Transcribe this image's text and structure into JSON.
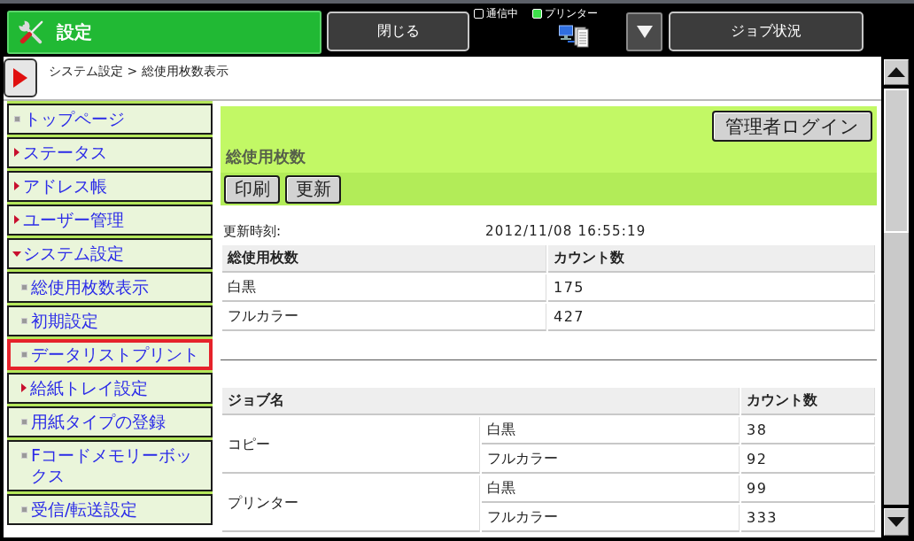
{
  "header": {
    "title": "設定",
    "close_button": "閉じる",
    "indicators": [
      {
        "label": "通信中",
        "on": false
      },
      {
        "label": "プリンター",
        "on": true
      }
    ],
    "job_status_button": "ジョブ状況"
  },
  "breadcrumb": "システム設定 > 総使用枚数表示",
  "sidebar": {
    "items": [
      {
        "label": "トップページ",
        "kind": "page",
        "selected": false
      },
      {
        "label": "ステータス",
        "kind": "folder",
        "expanded": false,
        "selected": false
      },
      {
        "label": "アドレス帳",
        "kind": "folder",
        "expanded": false,
        "selected": false
      },
      {
        "label": "ユーザー管理",
        "kind": "folder",
        "expanded": false,
        "selected": false
      },
      {
        "label": "システム設定",
        "kind": "folder",
        "expanded": true,
        "selected": false,
        "children": [
          {
            "label": "総使用枚数表示",
            "kind": "page",
            "selected": false
          },
          {
            "label": "初期設定",
            "kind": "page",
            "selected": false
          },
          {
            "label": "データリストプリント",
            "kind": "page",
            "selected": true
          },
          {
            "label": "給紙トレイ設定",
            "kind": "folder",
            "expanded": false,
            "selected": false
          },
          {
            "label": "用紙タイプの登録",
            "kind": "page",
            "selected": false
          },
          {
            "label": "Fコードメモリーボックス",
            "kind": "page",
            "selected": false
          },
          {
            "label": "受信/転送設定",
            "kind": "page",
            "selected": false
          }
        ]
      }
    ]
  },
  "panel": {
    "title": "総使用枚数",
    "login_button": "管理者ログイン",
    "buttons": [
      "印刷",
      "更新"
    ]
  },
  "updated": {
    "label": "更新時刻:",
    "value": "2012/11/08 16:55:19"
  },
  "total_table": {
    "columns": [
      "総使用枚数",
      "カウント数"
    ],
    "rows": [
      [
        "白黒",
        "175"
      ],
      [
        "フルカラー",
        "427"
      ]
    ]
  },
  "job_table": {
    "columns": [
      "ジョブ名",
      "カウント数"
    ],
    "groups": [
      {
        "job": "コピー",
        "rows": [
          [
            "白黒",
            "38"
          ],
          [
            "フルカラー",
            "92"
          ]
        ]
      },
      {
        "job": "プリンター",
        "rows": [
          [
            "白黒",
            "99"
          ],
          [
            "フルカラー",
            "333"
          ]
        ]
      }
    ]
  }
}
